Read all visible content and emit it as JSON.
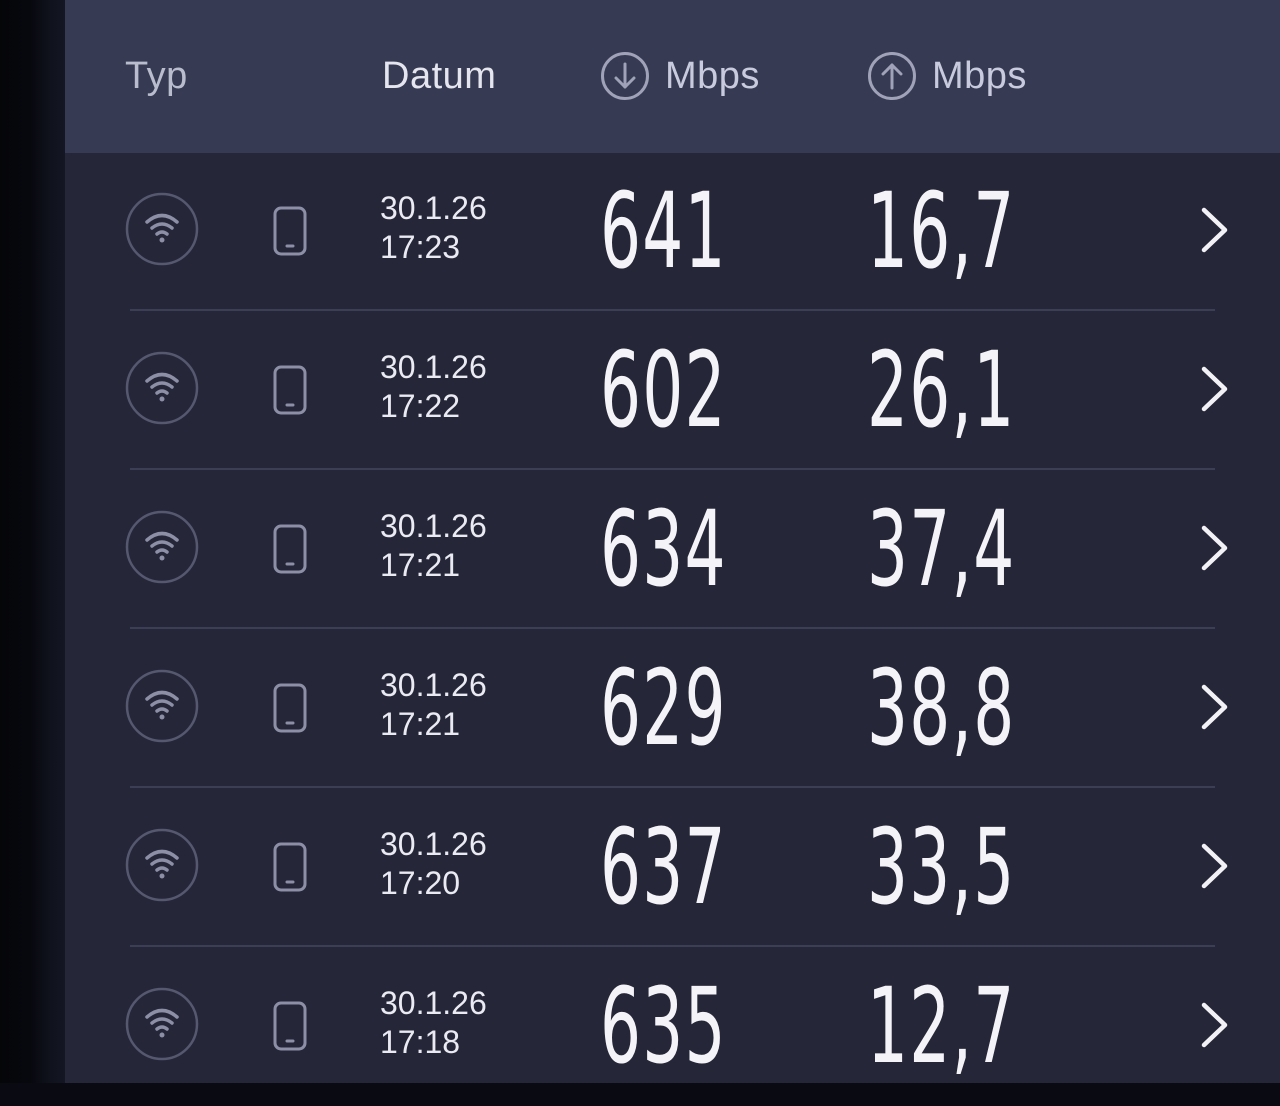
{
  "header": {
    "type_label": "Typ",
    "date_label": "Datum",
    "download_unit": "Mbps",
    "upload_unit": "Mbps",
    "download_icon": "arrow-down-circle-icon",
    "upload_icon": "arrow-up-circle-icon"
  },
  "rows": [
    {
      "connection_icon": "wifi-icon",
      "device_icon": "phone-icon",
      "date": "30.1.26",
      "time": "17:23",
      "download": "641",
      "upload": "16,7"
    },
    {
      "connection_icon": "wifi-icon",
      "device_icon": "phone-icon",
      "date": "30.1.26",
      "time": "17:22",
      "download": "602",
      "upload": "26,1"
    },
    {
      "connection_icon": "wifi-icon",
      "device_icon": "phone-icon",
      "date": "30.1.26",
      "time": "17:21",
      "download": "634",
      "upload": "37,4"
    },
    {
      "connection_icon": "wifi-icon",
      "device_icon": "phone-icon",
      "date": "30.1.26",
      "time": "17:21",
      "download": "629",
      "upload": "38,8"
    },
    {
      "connection_icon": "wifi-icon",
      "device_icon": "phone-icon",
      "date": "30.1.26",
      "time": "17:20",
      "download": "637",
      "upload": "33,5"
    },
    {
      "connection_icon": "wifi-icon",
      "device_icon": "phone-icon",
      "date": "30.1.26",
      "time": "17:18",
      "download": "635",
      "upload": "12,7"
    }
  ],
  "colors": {
    "background": "#262639",
    "header_background": "#363a52",
    "divider": "#3b3e55",
    "icon_muted": "#8c8fa6",
    "text_primary": "#f4f4f8"
  }
}
